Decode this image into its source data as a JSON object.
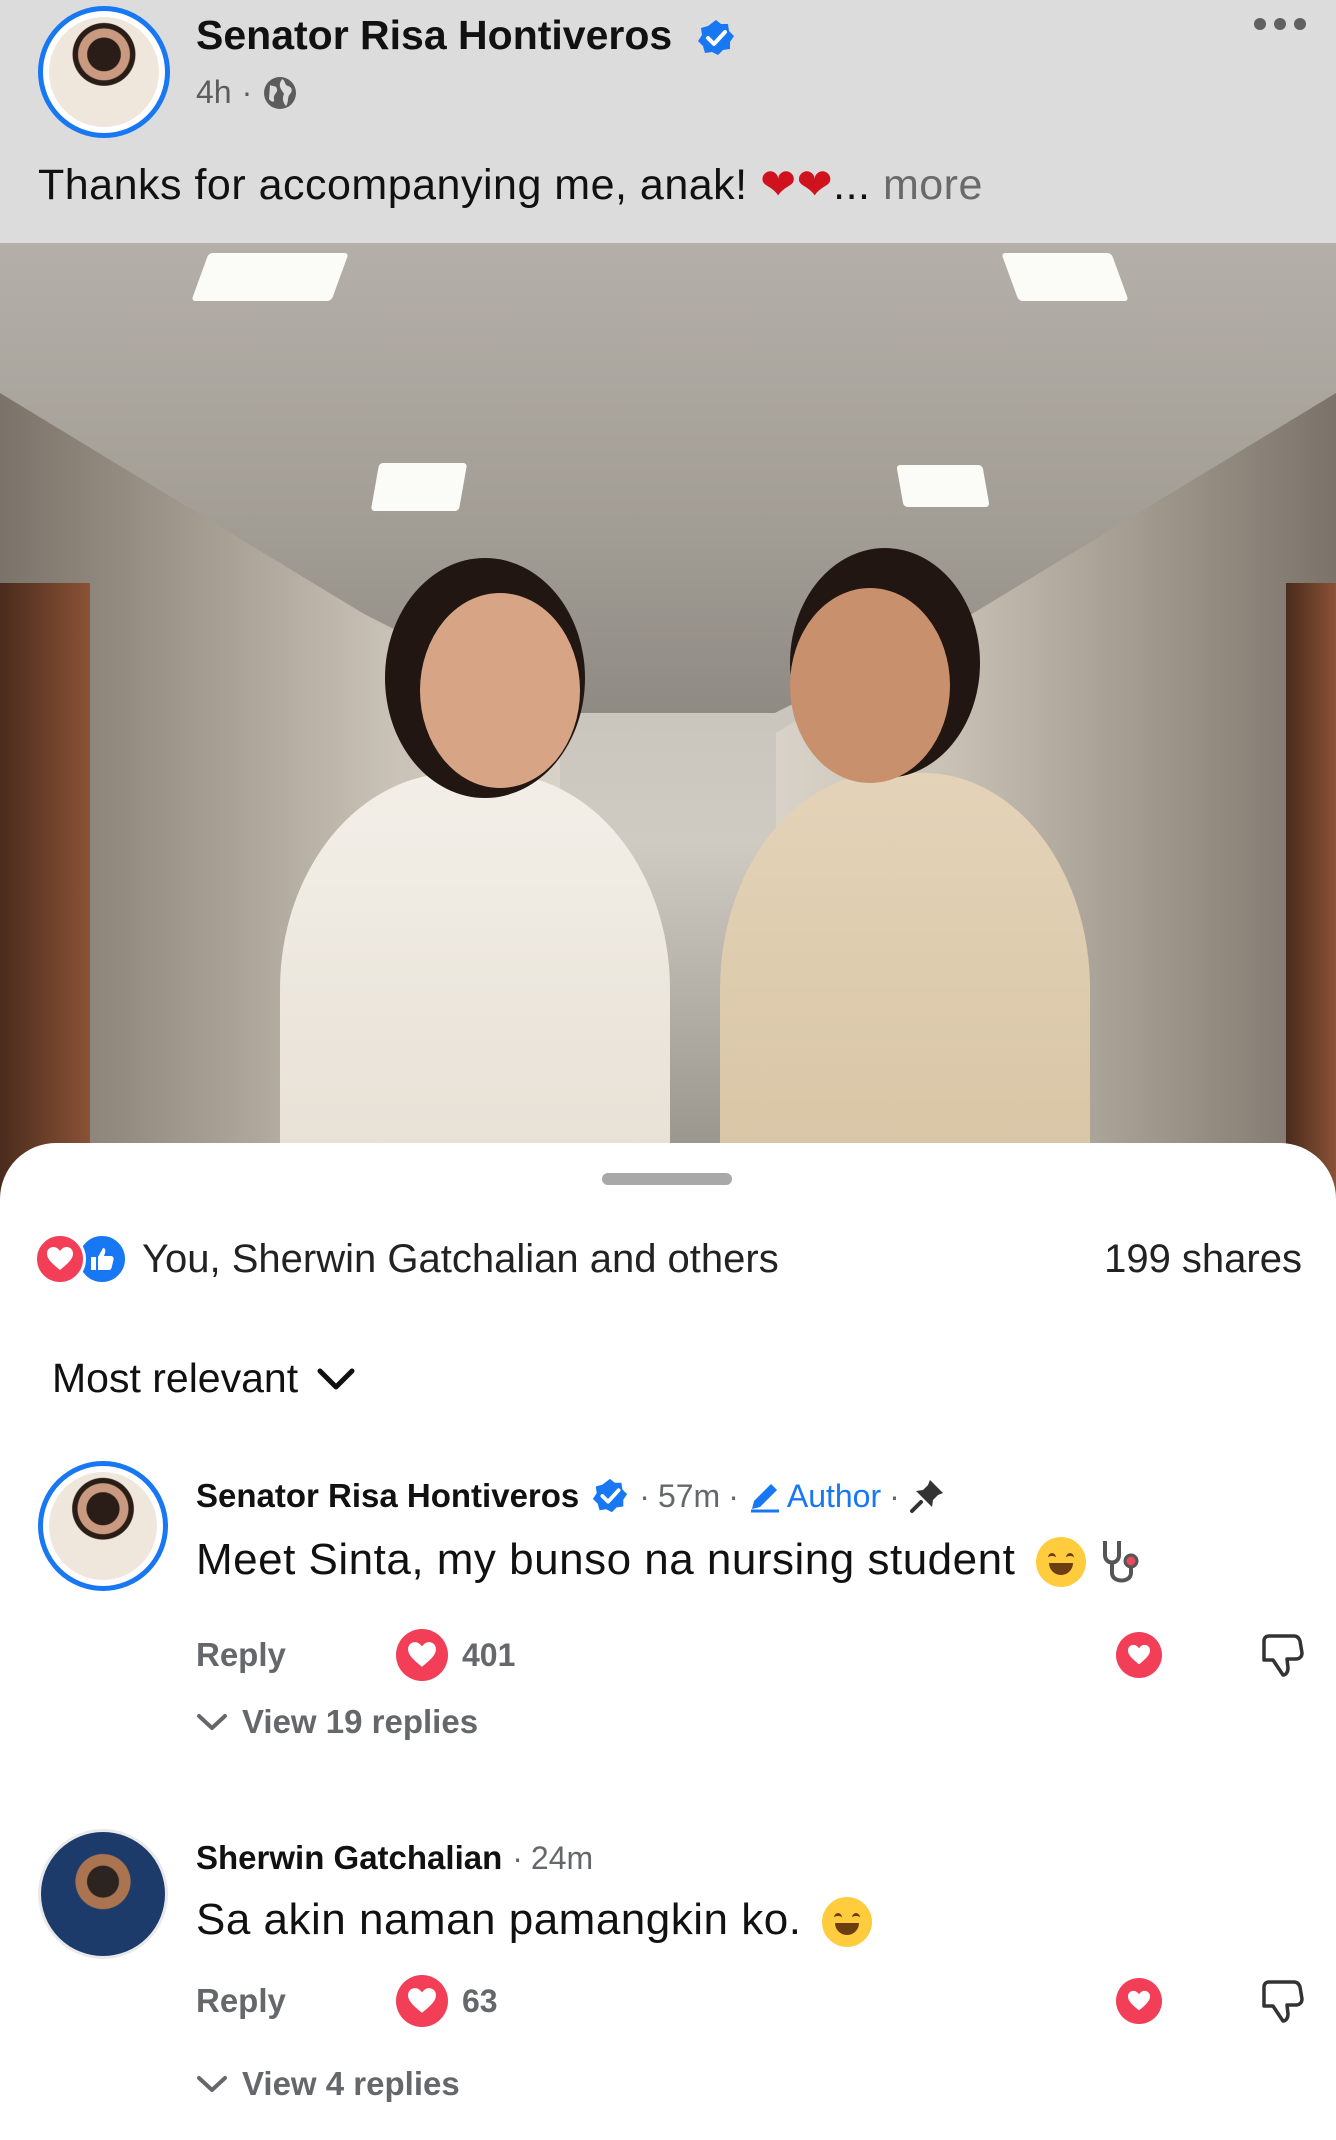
{
  "post": {
    "author": "Senator Risa Hontiveros",
    "time": "4h",
    "meta_sep": "·",
    "caption": "Thanks for accompanying me, anak!",
    "caption_hearts": "❤❤",
    "ellipsis": "...",
    "more_label": "more"
  },
  "engagement": {
    "reactions_text": "You, Sherwin Gatchalian and others",
    "shares_text": "199 shares"
  },
  "sort": {
    "label": "Most relevant"
  },
  "comments": [
    {
      "author": "Senator Risa Hontiveros",
      "time": "57m",
      "author_badge": "Author",
      "text": "Meet Sinta, my bunso na nursing student",
      "reply_label": "Reply",
      "reaction_count": "401",
      "view_replies": "View 19 replies"
    },
    {
      "author": "Sherwin Gatchalian",
      "time": "24m",
      "text": "Sa akin naman pamangkin ko.",
      "reply_label": "Reply",
      "reaction_count": "63",
      "view_replies": "View 4 replies"
    }
  ],
  "colors": {
    "brand_blue": "#1877f2",
    "love_red": "#f33e58",
    "muted_text": "#65676b"
  },
  "icons": [
    "verified-badge-icon",
    "globe-icon",
    "more-options-icon",
    "love-reaction-icon",
    "like-reaction-icon",
    "chevron-down-icon",
    "pencil-icon",
    "pin-icon",
    "dislike-icon",
    "grinning-emoji-icon",
    "stethoscope-emoji-icon",
    "smiling-emoji-icon"
  ]
}
